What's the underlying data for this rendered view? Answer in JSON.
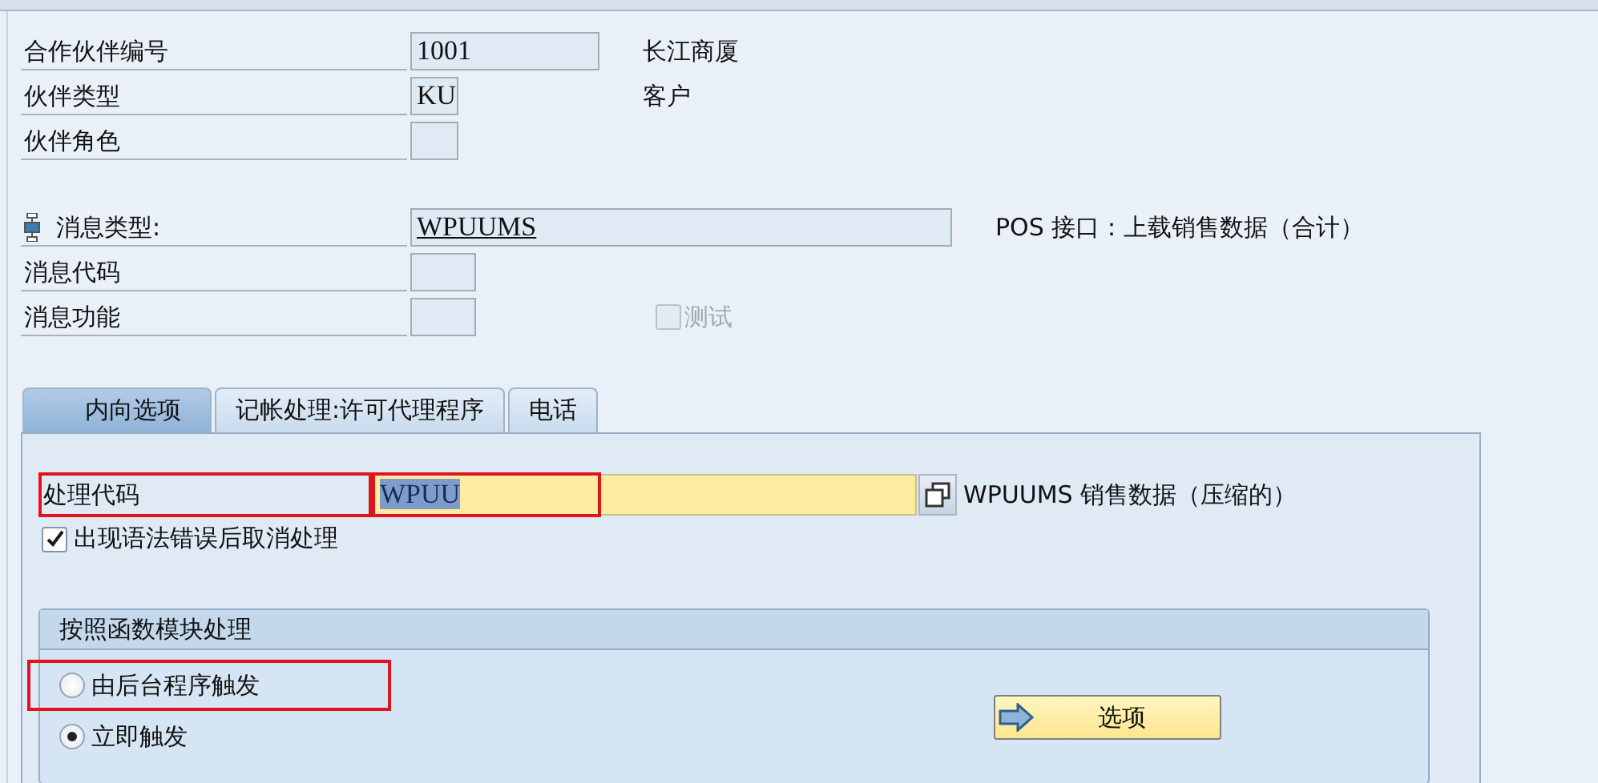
{
  "header_fields": [
    {
      "label": "合作伙伴编号",
      "value": "1001",
      "description": "长江商厦"
    },
    {
      "label": "伙伴类型",
      "value": "KU",
      "description": "客户"
    },
    {
      "label": "伙伴角色"
    }
  ],
  "message_fields": [
    {
      "label": "消息类型:",
      "value": "WPUUMS",
      "description": "POS 接口：上载销售数据（合计）",
      "kind": "icon"
    },
    {
      "label": "消息代码",
      "kind": "plain"
    },
    {
      "label": "消息功能",
      "kind": "plain",
      "checkbox": {
        "label": "测试",
        "checked": false,
        "disabled": true
      }
    }
  ],
  "tabs": [
    {
      "label": "内向选项",
      "selected": true
    },
    {
      "label": "记帐处理:许可代理程序",
      "selected": false
    },
    {
      "label": "电话",
      "selected": false
    }
  ],
  "process_code": {
    "label": "处理代码",
    "value": "WPUU",
    "highlighted": true,
    "description": "WPUUMS  销售数据（压缩的）"
  },
  "cancel_checkbox": {
    "label": "出现语法错误后取消处理",
    "checked": true
  },
  "group": {
    "title": "按照函数模块处理",
    "options": [
      {
        "label": "由后台程序触发",
        "selected": false,
        "highlighted": true
      },
      {
        "label": "立即触发",
        "selected": true,
        "highlighted": false
      }
    ],
    "button": "选项"
  }
}
